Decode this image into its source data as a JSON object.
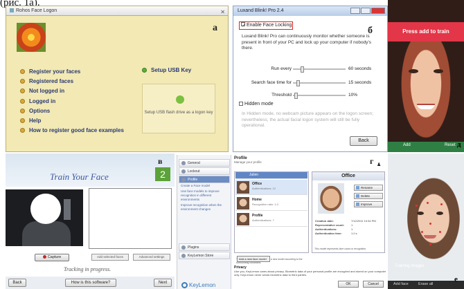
{
  "caption": "(рис. 1а).",
  "panel_a": {
    "window_title": "Rohos Face Logon",
    "letter": "а",
    "menu": [
      "Register your faces",
      "Registered faces",
      "Not logged in",
      "Logged in",
      "Options",
      "Help",
      "How to register good face examples"
    ],
    "usb_title": "Setup USB Key",
    "usb_desc": "Setup USB flash drive as a logon key"
  },
  "panel_b": {
    "window_title": "Luxand Blink! Pro 2.4",
    "letter": "б",
    "enable_label": "Enable Face Locking",
    "description": "Luxand Blink! Pro can continuously monitor whether someone is present in front of your PC and lock up your computer if nobody's there.",
    "sliders": [
      {
        "label": "Run every",
        "value": "60 seconds",
        "fraction": 0.14
      },
      {
        "label": "Search face time for",
        "value": "15 seconds",
        "fraction": 0.06
      },
      {
        "label": "Threshold",
        "value": "10%",
        "fraction": 0.02
      }
    ],
    "hidden_label": "Hidden mode",
    "hidden_desc": "In Hidden mode, no webcam picture appears on the logon screen; nevertheless, the actual facial logon system will still be fully operational.",
    "back_label": "Back"
  },
  "panel_tr": {
    "banner": "Press add to train",
    "btn_add": "Add",
    "btn_reset": "Reset",
    "letter": "д"
  },
  "panel_v": {
    "letter": "в",
    "title": "Train Your Face",
    "step": "2",
    "capture_label": "Capture",
    "btn_mid1": "Add selected faces",
    "btn_mid2": "Advanced settings",
    "progress": "Tracking in progress.",
    "back": "Back",
    "help": "How is this software?",
    "next": "Next"
  },
  "panel_g": {
    "letter": "г",
    "sidebar": [
      "General",
      "Lockout",
      "Profile"
    ],
    "sidebar_links": [
      "Create a Face model",
      "Use face models to improve recognition in different environments",
      "Improve recognition when the environment changes"
    ],
    "sidebar_bottom": [
      "Plugins",
      "KeyLemon Store"
    ],
    "logo": "KeyLemon",
    "profile_title": "Profile",
    "profile_sub": "Manage your profile",
    "list_header": "Julien",
    "users": [
      {
        "name": "Office",
        "sub": "Authentications: 12"
      },
      {
        "name": "Home",
        "sub": "Recognition ratio: 1.0"
      },
      {
        "name": "Profile",
        "sub": "Authentications: 7"
      }
    ],
    "detail_title": "Office",
    "actions": [
      "Rename",
      "Delete",
      "Improve"
    ],
    "kv": [
      {
        "k": "Creation date:",
        "v": "7/12/2011 10:34 PM"
      },
      {
        "k": "Representative count:",
        "v": "1"
      },
      {
        "k": "Authentications:",
        "v": "1"
      },
      {
        "k": "Authentication time:",
        "v": "1.0 s"
      }
    ],
    "note": "The best recognized model has a new model according to the surrounding conditions.",
    "add_btn": "Add a new face model",
    "note2": "This model represents face cases in recognition.",
    "privacy_title": "Privacy",
    "privacy": "Like you, KeyLemon cares about privacy. Biometric data of your personal profile are encrypted and stored on your computer only. KeyLemon never sends biometric data to third parties.",
    "ok": "OK",
    "cancel": "Cancel"
  },
  "panel_br": {
    "training": "Training images",
    "btn_add": "Add face",
    "btn_erase": "Erase all",
    "letter": "е"
  }
}
